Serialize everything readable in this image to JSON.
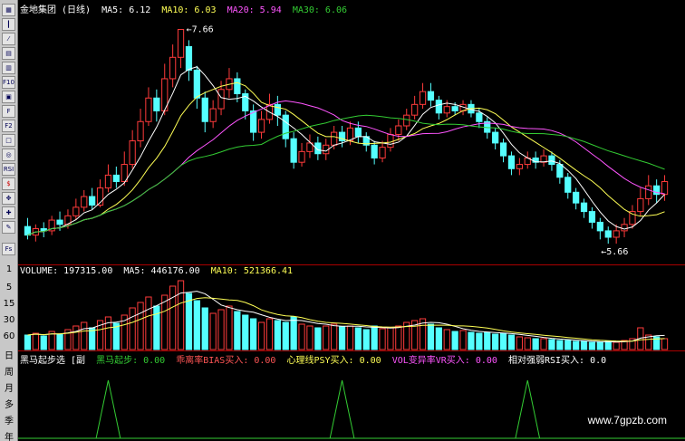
{
  "price_header": {
    "name": "金地集团 (日线)",
    "ma5": "MA5: 6.12",
    "ma10": "MA10: 6.03",
    "ma20": "MA20: 5.94",
    "ma30": "MA30: 6.06",
    "high_label": "7.66",
    "low_label": "5.66"
  },
  "volume_header": {
    "volume": "VOLUME: 197315.00",
    "ma5": "MA5: 446176.00",
    "ma10": "MA10: 521366.41"
  },
  "indicator_header": {
    "name": "黑马起步选 [副",
    "s1": "黑马起步: 0.00",
    "s2": "乖离率BIAS买入: 0.00",
    "s3": "心理线PSY买入: 0.00",
    "s4": "VOL变异率VR买入: 0.00",
    "s5": "相对强弱RSI买入: 0.0"
  },
  "left_axis": [
    "1",
    "5",
    "15",
    "30",
    "60",
    "日",
    "周",
    "月",
    "多",
    "季",
    "年"
  ],
  "watermark": "www.7gpzb.com",
  "colors": {
    "up": "#ff3b3b",
    "down": "#55ffff",
    "ma5": "#ffffff",
    "ma10": "#ffff55",
    "ma20": "#ff55ff",
    "ma30": "#33cc33"
  },
  "chart_data": {
    "type": "candlestick",
    "price_range": [
      5.5,
      7.8
    ],
    "candles": [
      [
        5.82,
        5.74,
        5.9,
        5.7
      ],
      [
        5.74,
        5.8,
        5.84,
        5.68
      ],
      [
        5.8,
        5.78,
        5.86,
        5.72
      ],
      [
        5.78,
        5.88,
        5.92,
        5.74
      ],
      [
        5.88,
        5.84,
        5.96,
        5.78
      ],
      [
        5.84,
        5.92,
        5.98,
        5.8
      ],
      [
        5.92,
        6.0,
        6.08,
        5.88
      ],
      [
        6.0,
        6.1,
        6.16,
        5.96
      ],
      [
        6.1,
        6.02,
        6.18,
        5.98
      ],
      [
        6.02,
        6.18,
        6.26,
        6.0
      ],
      [
        6.18,
        6.3,
        6.4,
        6.14
      ],
      [
        6.3,
        6.24,
        6.38,
        6.18
      ],
      [
        6.24,
        6.4,
        6.52,
        6.2
      ],
      [
        6.4,
        6.62,
        6.72,
        6.36
      ],
      [
        6.62,
        6.8,
        6.92,
        6.56
      ],
      [
        6.8,
        7.02,
        7.12,
        6.76
      ],
      [
        7.02,
        6.9,
        7.1,
        6.8
      ],
      [
        6.9,
        7.2,
        7.34,
        6.86
      ],
      [
        7.2,
        7.4,
        7.52,
        7.12
      ],
      [
        7.4,
        7.66,
        7.66,
        7.3
      ],
      [
        7.5,
        7.28,
        7.56,
        7.18
      ],
      [
        7.28,
        7.02,
        7.32,
        6.92
      ],
      [
        7.02,
        6.8,
        7.08,
        6.7
      ],
      [
        6.8,
        6.92,
        7.0,
        6.74
      ],
      [
        6.92,
        7.1,
        7.18,
        6.86
      ],
      [
        7.1,
        7.2,
        7.3,
        7.02
      ],
      [
        7.2,
        7.06,
        7.26,
        6.98
      ],
      [
        7.06,
        6.9,
        7.1,
        6.82
      ],
      [
        6.9,
        6.7,
        6.96,
        6.62
      ],
      [
        6.7,
        6.82,
        6.9,
        6.64
      ],
      [
        6.82,
        6.96,
        7.06,
        6.78
      ],
      [
        6.96,
        6.86,
        7.04,
        6.76
      ],
      [
        6.86,
        6.64,
        6.9,
        6.56
      ],
      [
        6.64,
        6.42,
        6.7,
        6.36
      ],
      [
        6.42,
        6.52,
        6.6,
        6.38
      ],
      [
        6.52,
        6.6,
        6.68,
        6.46
      ],
      [
        6.6,
        6.5,
        6.66,
        6.44
      ],
      [
        6.5,
        6.58,
        6.64,
        6.44
      ],
      [
        6.58,
        6.7,
        6.76,
        6.54
      ],
      [
        6.7,
        6.62,
        6.76,
        6.56
      ],
      [
        6.62,
        6.74,
        6.8,
        6.58
      ],
      [
        6.74,
        6.66,
        6.8,
        6.6
      ],
      [
        6.66,
        6.58,
        6.7,
        6.52
      ],
      [
        6.58,
        6.46,
        6.62,
        6.4
      ],
      [
        6.46,
        6.56,
        6.62,
        6.42
      ],
      [
        6.56,
        6.68,
        6.74,
        6.52
      ],
      [
        6.68,
        6.76,
        6.82,
        6.62
      ],
      [
        6.76,
        6.86,
        6.92,
        6.72
      ],
      [
        6.86,
        6.96,
        7.04,
        6.82
      ],
      [
        6.96,
        7.08,
        7.16,
        6.92
      ],
      [
        7.08,
        7.0,
        7.16,
        6.94
      ],
      [
        7.0,
        6.88,
        7.04,
        6.82
      ],
      [
        6.88,
        6.94,
        7.0,
        6.84
      ],
      [
        6.94,
        6.9,
        6.98,
        6.86
      ],
      [
        6.9,
        6.96,
        7.0,
        6.86
      ],
      [
        6.96,
        6.88,
        7.0,
        6.84
      ],
      [
        6.88,
        6.8,
        6.92,
        6.74
      ],
      [
        6.8,
        6.7,
        6.84,
        6.64
      ],
      [
        6.7,
        6.6,
        6.74,
        6.54
      ],
      [
        6.6,
        6.48,
        6.64,
        6.42
      ],
      [
        6.48,
        6.36,
        6.52,
        6.3
      ],
      [
        6.36,
        6.4,
        6.46,
        6.3
      ],
      [
        6.4,
        6.46,
        6.52,
        6.36
      ],
      [
        6.46,
        6.42,
        6.52,
        6.36
      ],
      [
        6.42,
        6.48,
        6.54,
        6.38
      ],
      [
        6.48,
        6.4,
        6.52,
        6.34
      ],
      [
        6.4,
        6.28,
        6.44,
        6.22
      ],
      [
        6.28,
        6.14,
        6.32,
        6.08
      ],
      [
        6.14,
        6.04,
        6.18,
        5.98
      ],
      [
        6.04,
        5.96,
        6.08,
        5.9
      ],
      [
        5.96,
        5.86,
        6.0,
        5.8
      ],
      [
        5.86,
        5.78,
        5.9,
        5.7
      ],
      [
        5.78,
        5.72,
        5.82,
        5.66
      ],
      [
        5.72,
        5.78,
        5.84,
        5.66
      ],
      [
        5.78,
        5.84,
        5.9,
        5.72
      ],
      [
        5.84,
        5.96,
        6.02,
        5.8
      ],
      [
        5.96,
        6.08,
        6.18,
        5.92
      ],
      [
        6.08,
        6.2,
        6.3,
        6.02
      ],
      [
        6.2,
        6.12,
        6.26,
        6.04
      ],
      [
        6.12,
        6.24,
        6.3,
        6.06
      ]
    ],
    "volumes": [
      1.6,
      1.8,
      1.5,
      2.0,
      1.7,
      2.2,
      2.6,
      3.0,
      2.4,
      3.2,
      3.6,
      2.9,
      3.8,
      4.6,
      5.2,
      5.8,
      4.8,
      6.0,
      7.0,
      7.6,
      6.2,
      5.4,
      4.6,
      4.0,
      4.4,
      4.8,
      4.2,
      3.8,
      3.4,
      3.0,
      3.4,
      3.2,
      3.0,
      3.6,
      2.8,
      2.6,
      2.4,
      2.6,
      2.8,
      2.5,
      2.6,
      2.4,
      2.2,
      2.6,
      2.3,
      2.4,
      2.6,
      3.0,
      3.2,
      3.4,
      2.8,
      2.4,
      2.2,
      2.0,
      2.1,
      1.9,
      1.8,
      1.9,
      1.7,
      1.8,
      1.6,
      1.4,
      1.3,
      1.2,
      1.2,
      1.1,
      1.0,
      1.0,
      0.9,
      0.9,
      0.8,
      0.8,
      0.9,
      0.8,
      1.0,
      1.2,
      2.4,
      1.6,
      1.4,
      1.2
    ],
    "vol_range": [
      0,
      8
    ],
    "signals": [
      {
        "index": 10,
        "value": 1
      },
      {
        "index": 39,
        "value": 1
      },
      {
        "index": 62,
        "value": 1
      }
    ]
  }
}
